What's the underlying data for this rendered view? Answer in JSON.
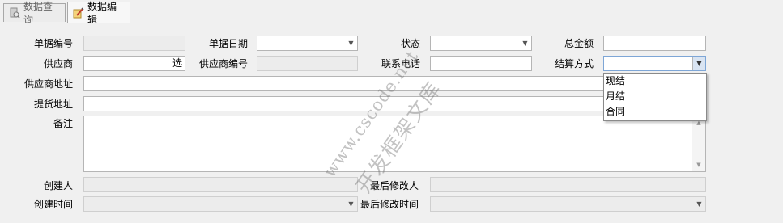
{
  "tabs": [
    {
      "label": "数据查询",
      "active": false,
      "icon": "database-search-icon"
    },
    {
      "label": "数据编辑",
      "active": true,
      "icon": "edit-icon"
    }
  ],
  "form": {
    "doc_no_label": "单据编号",
    "doc_no_value": "",
    "doc_date_label": "单据日期",
    "doc_date_value": "",
    "status_label": "状态",
    "status_value": "",
    "total_label": "总金额",
    "total_value": "",
    "supplier_label": "供应商",
    "supplier_value": "",
    "supplier_pick": "选",
    "supplier_code_label": "供应商编号",
    "supplier_code_value": "",
    "phone_label": "联系电话",
    "phone_value": "",
    "settle_label": "结算方式",
    "settle_value": "",
    "supplier_addr_label": "供应商地址",
    "supplier_addr_value": "",
    "pickup_addr_label": "提货地址",
    "pickup_addr_value": "",
    "remark_label": "备注",
    "remark_value": "",
    "creator_label": "创建人",
    "creator_value": "",
    "last_editor_label": "最后修改人",
    "last_editor_value": "",
    "created_time_label": "创建时间",
    "created_time_value": "",
    "last_edit_time_label": "最后修改时间",
    "last_edit_time_value": ""
  },
  "settle_options": [
    "现结",
    "月结",
    "合同"
  ],
  "watermark": {
    "line1": "www.cscode.net",
    "line2": "开发框架文库"
  }
}
